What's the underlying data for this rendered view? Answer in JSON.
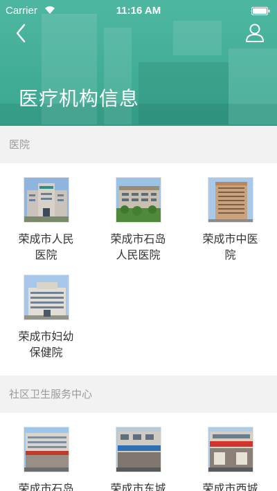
{
  "status_bar": {
    "carrier": "Carrier",
    "time": "11:16 AM"
  },
  "header": {
    "title": "医疗机构信息",
    "back_icon": "chevron-left-icon",
    "user_icon": "user-icon"
  },
  "sections": [
    {
      "title": "医院",
      "items": [
        {
          "name": "荣成市人民医院"
        },
        {
          "name": "荣成市石岛人民医院"
        },
        {
          "name": "荣成市中医院"
        },
        {
          "name": "荣成市妇幼保健院"
        }
      ]
    },
    {
      "title": "社区卫生服务中心",
      "items": [
        {
          "name": "荣成市石岛"
        },
        {
          "name": "荣成市东城"
        },
        {
          "name": "荣成市西城"
        }
      ]
    }
  ],
  "colors": {
    "header": "#44af98",
    "section_bg": "#f2f2f2",
    "section_text": "#9a9a9a"
  }
}
